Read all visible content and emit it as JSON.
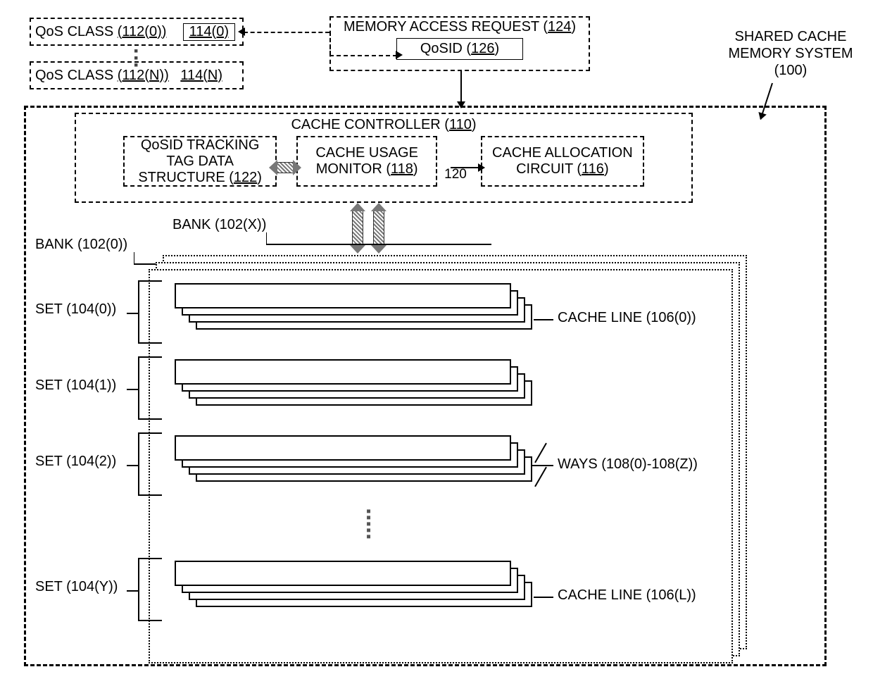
{
  "title_label": "SHARED CACHE MEMORY SYSTEM",
  "title_ref": "(100)",
  "qos": {
    "class0_label": "QoS CLASS",
    "class0_ref": "(112(0))",
    "class0_inner": "114(0)",
    "classN_label": "QoS CLASS",
    "classN_ref": "(112(N))",
    "classN_inner": "114(N)"
  },
  "mar": {
    "title": "MEMORY ACCESS REQUEST",
    "title_ref": "(124)",
    "qosid_label": "QoSID",
    "qosid_ref": "(126)"
  },
  "controller": {
    "title": "CACHE CONTROLLER",
    "title_ref": "(110)",
    "track_l1": "QoSID TRACKING",
    "track_l2": "TAG DATA",
    "track_l3": "STRUCTURE",
    "track_ref": "(122)",
    "monitor_l1": "CACHE USAGE",
    "monitor_l2": "MONITOR",
    "monitor_ref": "(118)",
    "num120": "120",
    "alloc_l1": "CACHE ALLOCATION",
    "alloc_l2": "CIRCUIT",
    "alloc_ref": "(116)"
  },
  "banks": {
    "bank0": "BANK (102(0))",
    "bankX": "BANK (102(X))"
  },
  "sets": {
    "s0": "SET (104(0))",
    "s1": "SET (104(1))",
    "s2": "SET (104(2))",
    "sY": "SET (104(Y))"
  },
  "lines": {
    "cl0": "CACHE LINE (106(0))",
    "clL": "CACHE LINE (106(L))",
    "ways": "WAYS (108(0)-108(Z))"
  }
}
